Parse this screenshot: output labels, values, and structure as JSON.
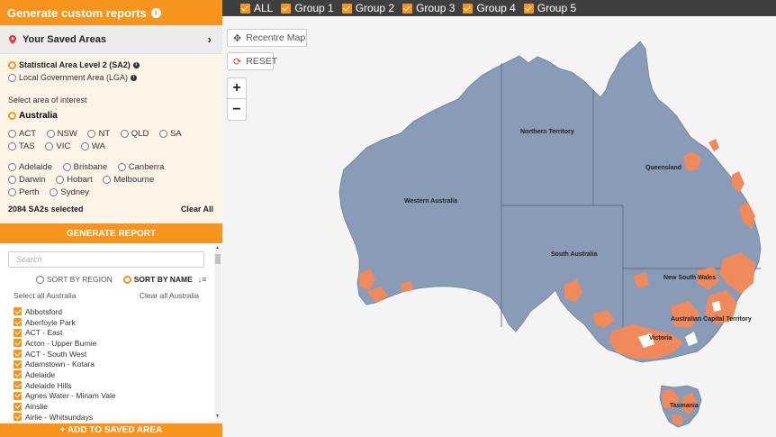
{
  "header": {
    "title": "Generate custom reports"
  },
  "saved_areas": {
    "label": "Your Saved Areas"
  },
  "area_level": {
    "options": [
      {
        "label": "Statistical Area Level 2 (SA2)",
        "selected": true
      },
      {
        "label": "Local Government Area (LGA)",
        "selected": false
      }
    ]
  },
  "area_of_interest": {
    "label": "Select area of interest",
    "australia": "Australia",
    "states_row1": [
      "ACT",
      "NSW",
      "NT",
      "QLD",
      "SA"
    ],
    "states_row2": [
      "TAS",
      "VIC",
      "WA"
    ],
    "cities_row1": [
      "Adelaide",
      "Brisbane",
      "Canberra"
    ],
    "cities_row2": [
      "Darwin",
      "Hobart",
      "Melbourne"
    ],
    "cities_row3": [
      "Perth",
      "Sydney"
    ]
  },
  "selection": {
    "count_text": "2084 SA2s selected",
    "clear_all": "Clear All"
  },
  "generate_report": "GENERATE REPORT",
  "list": {
    "search_placeholder": "Search",
    "sort_by_region": "SORT BY REGION",
    "sort_by_name": "SORT BY NAME",
    "select_all": "Select all Australia",
    "clear_all": "Clear all Australia",
    "items": [
      "Abbotsford",
      "Aberfoyle Park",
      "ACT - East",
      "Acton - Upper Burnie",
      "ACT - South West",
      "Adamstown - Kotara",
      "Adelaide",
      "Adelaide Hills",
      "Agnes Water - Miriam Vale",
      "Ainslie",
      "Airlie - Whitsundays"
    ]
  },
  "add_saved": "+ ADD TO SAVED AREA",
  "groups": [
    "ALL",
    "Group 1",
    "Group 2",
    "Group 3",
    "Group 4",
    "Group 5"
  ],
  "map": {
    "recentre": "Recentre Map",
    "reset": "RESET",
    "zoom_in": "+",
    "zoom_out": "−",
    "labels": {
      "nt": "Northern Territory",
      "qld": "Queensland",
      "wa": "Western Australia",
      "sa": "South Australia",
      "nsw": "New South Wales",
      "act": "Australian Capital Territory",
      "vic": "Victoria",
      "tas": "Tasmania"
    }
  },
  "colors": {
    "accent": "#f7941d",
    "land": "#8a9bb8",
    "highlight": "#f08a5d",
    "topbar": "#3f3f3f"
  }
}
